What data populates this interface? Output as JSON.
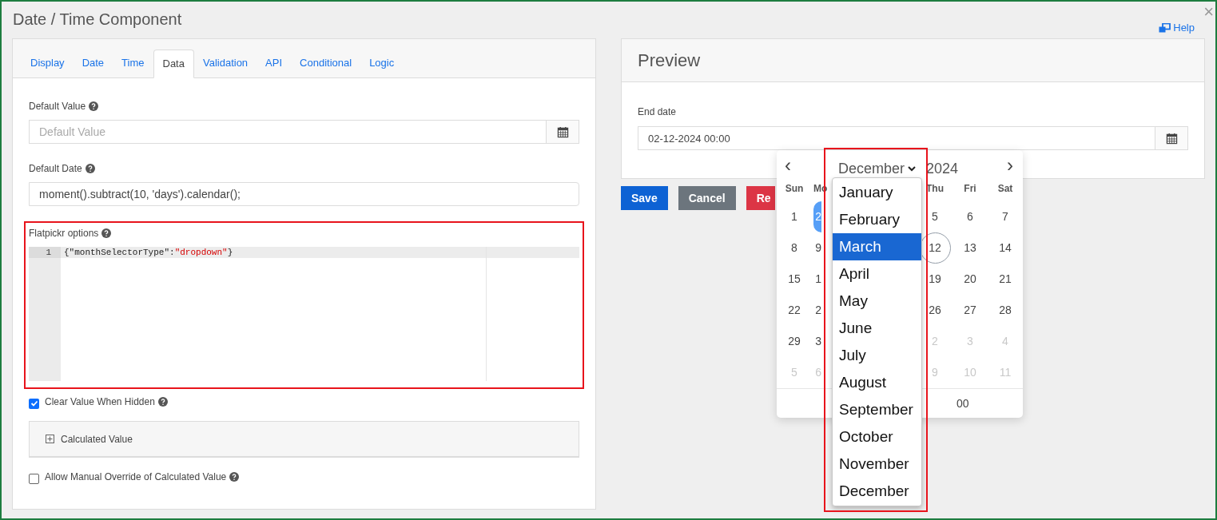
{
  "window": {
    "title": "Date / Time Component",
    "close": "×"
  },
  "help_link": "Help",
  "tabs": [
    {
      "label": "Display",
      "selected": false
    },
    {
      "label": "Date",
      "selected": false
    },
    {
      "label": "Time",
      "selected": false
    },
    {
      "label": "Data",
      "selected": true
    },
    {
      "label": "Validation",
      "selected": false
    },
    {
      "label": "API",
      "selected": false
    },
    {
      "label": "Conditional",
      "selected": false
    },
    {
      "label": "Logic",
      "selected": false
    }
  ],
  "fields": [
    {
      "label": "Default Value",
      "placeholder": "Default Value",
      "calendar_button": true
    },
    {
      "label": "Default Date",
      "value": "moment().subtract(10, 'days').calendar();",
      "calendar_button": false
    }
  ],
  "editor": {
    "label": "Flatpickr options",
    "lines": [
      {
        "number": "1",
        "tokens": [
          {
            "kind": "plain",
            "text": "{\"monthSelectorType\":"
          },
          {
            "kind": "string",
            "text": "\"dropdown\""
          },
          {
            "kind": "plain",
            "text": "}"
          }
        ]
      }
    ]
  },
  "options": [
    {
      "kind": "checkbox",
      "label": "Clear Value When Hidden",
      "checked": true
    },
    {
      "kind": "panel",
      "title": "Calculated Value",
      "expanded": false
    },
    {
      "kind": "checkbox",
      "label": "Allow Manual Override of Calculated Value",
      "checked": false
    }
  ],
  "preview": {
    "title": "Preview",
    "field_label": "End date",
    "value": "02-12-2024 00:00",
    "buttons": [
      {
        "label": "Save",
        "kind": "primary"
      },
      {
        "label": "Cancel",
        "kind": "secondary"
      },
      {
        "label": "Re",
        "kind": "danger"
      }
    ]
  },
  "datepicker": {
    "month": "December",
    "year": "2024",
    "prev": "‹",
    "next": "›",
    "weekdays": [
      "Sun",
      "Mo",
      "Thu",
      "Fri",
      "Sat"
    ],
    "weeks": [
      [
        {
          "day": "1",
          "kind": "month",
          "selected": false
        },
        {
          "day": "2",
          "kind": "month",
          "selected": true
        },
        {
          "day": "5",
          "kind": "month",
          "selected": false
        },
        {
          "day": "6",
          "kind": "month",
          "selected": false
        },
        {
          "day": "7",
          "kind": "month",
          "selected": false
        }
      ],
      [
        {
          "day": "8",
          "kind": "month",
          "selected": false
        },
        {
          "day": "9",
          "kind": "month",
          "selected": false
        },
        {
          "day": "12",
          "kind": "today",
          "selected": false
        },
        {
          "day": "13",
          "kind": "month",
          "selected": false
        },
        {
          "day": "14",
          "kind": "month",
          "selected": false
        }
      ],
      [
        {
          "day": "15",
          "kind": "month",
          "selected": false
        },
        {
          "day": "1",
          "kind": "month",
          "selected": false
        },
        {
          "day": "19",
          "kind": "month",
          "selected": false
        },
        {
          "day": "20",
          "kind": "month",
          "selected": false
        },
        {
          "day": "21",
          "kind": "month",
          "selected": false
        }
      ],
      [
        {
          "day": "22",
          "kind": "month",
          "selected": false
        },
        {
          "day": "2",
          "kind": "month",
          "selected": false
        },
        {
          "day": "26",
          "kind": "month",
          "selected": false
        },
        {
          "day": "27",
          "kind": "month",
          "selected": false
        },
        {
          "day": "28",
          "kind": "month",
          "selected": false
        }
      ],
      [
        {
          "day": "29",
          "kind": "month",
          "selected": false
        },
        {
          "day": "3",
          "kind": "month",
          "selected": false
        },
        {
          "day": "2",
          "kind": "outside",
          "selected": false
        },
        {
          "day": "3",
          "kind": "outside",
          "selected": false
        },
        {
          "day": "4",
          "kind": "outside",
          "selected": false
        }
      ],
      [
        {
          "day": "5",
          "kind": "outside",
          "selected": false
        },
        {
          "day": "6",
          "kind": "outside",
          "selected": false
        },
        {
          "day": "9",
          "kind": "outside",
          "selected": false
        },
        {
          "day": "10",
          "kind": "outside",
          "selected": false
        },
        {
          "day": "11",
          "kind": "outside",
          "selected": false
        }
      ]
    ],
    "minute": "00",
    "months": [
      {
        "label": "January",
        "selected": false
      },
      {
        "label": "February",
        "selected": false
      },
      {
        "label": "March",
        "selected": true
      },
      {
        "label": "April",
        "selected": false
      },
      {
        "label": "May",
        "selected": false
      },
      {
        "label": "June",
        "selected": false
      },
      {
        "label": "July",
        "selected": false
      },
      {
        "label": "August",
        "selected": false
      },
      {
        "label": "September",
        "selected": false
      },
      {
        "label": "October",
        "selected": false
      },
      {
        "label": "November",
        "selected": false
      },
      {
        "label": "December",
        "selected": false
      }
    ]
  }
}
